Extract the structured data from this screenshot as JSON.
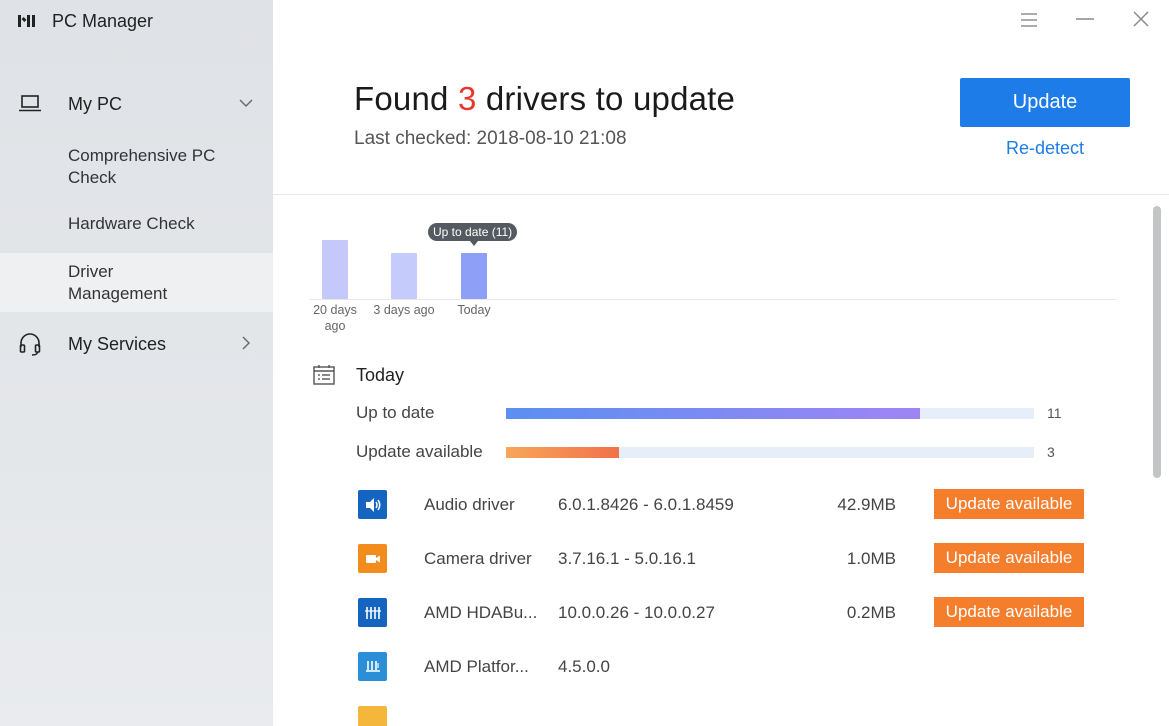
{
  "app": {
    "title": "PC Manager"
  },
  "sidebar": {
    "my_pc": {
      "label": "My PC",
      "items": [
        {
          "label": "Comprehensive PC Check"
        },
        {
          "label": "Hardware Check"
        },
        {
          "label": "Driver Management",
          "active": true
        }
      ]
    },
    "my_services": {
      "label": "My Services"
    }
  },
  "header": {
    "title_prefix": "Found ",
    "count": "3",
    "title_suffix": " drivers to update",
    "last_checked": "Last checked: 2018-08-10 21:08",
    "update_label": "Update",
    "redetect_label": "Re-detect"
  },
  "history": {
    "tooltip": "Up to date (11)",
    "bars": [
      {
        "label": "20 days ago",
        "value": 14,
        "color": "#c5c8fb"
      },
      {
        "label": "3 days ago",
        "value": 11,
        "color": "#c5cbfb"
      },
      {
        "label": "Today",
        "value": 11,
        "color": "#8d9ff6"
      }
    ]
  },
  "section": {
    "title": "Today",
    "stats": [
      {
        "label": "Up to date",
        "count": "11",
        "fraction": 0.785,
        "gradient": [
          "#5b8ff2",
          "#9f85f4"
        ]
      },
      {
        "label": "Update available",
        "count": "3",
        "fraction": 0.214,
        "gradient": [
          "#f7a65a",
          "#f2714a"
        ]
      }
    ]
  },
  "drivers": [
    {
      "name": "Audio driver",
      "version": "6.0.1.8426 - 6.0.1.8459",
      "size": "42.9MB",
      "status": "Update available",
      "icon": "speaker-icon",
      "color": "#1565c0"
    },
    {
      "name": "Camera driver",
      "version": "3.7.16.1 - 5.0.16.1",
      "size": "1.0MB",
      "status": "Update available",
      "icon": "camera-icon",
      "color": "#f28c1c"
    },
    {
      "name": "AMD HDABu...",
      "version": "10.0.0.26 - 10.0.0.27",
      "size": "0.2MB",
      "status": "Update available",
      "icon": "bus-icon",
      "color": "#1565c0"
    },
    {
      "name": "AMD Platfor...",
      "version": "4.5.0.0",
      "size": "",
      "status": "",
      "icon": "chip-icon",
      "color": "#2b8fd8"
    }
  ]
}
